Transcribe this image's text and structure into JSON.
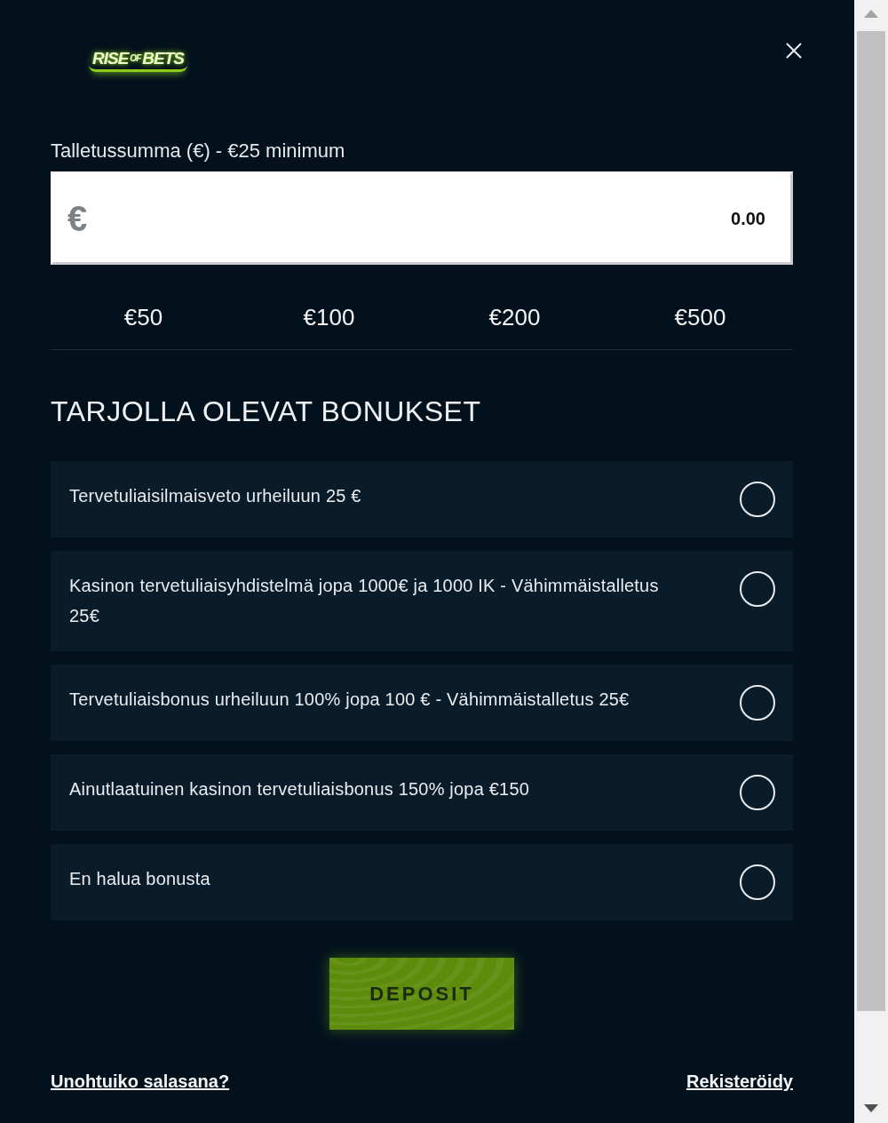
{
  "logo": {
    "parts": [
      "RISE",
      "OF",
      "BETS"
    ]
  },
  "amount": {
    "label": "Talletussumma (€) - €25 minimum",
    "currency": "€",
    "value": "0.00"
  },
  "quick_amounts": [
    "€50",
    "€100",
    "€200",
    "€500"
  ],
  "bonuses": {
    "heading": "TARJOLLA OLEVAT BONUKSET",
    "items": [
      {
        "label": "Tervetuliaisilmaisveto urheiluun 25 €",
        "selected": false
      },
      {
        "label": "Kasinon tervetuliaisyhdistelmä jopa 1000€ ja 1000 IK - Vähimmäistalletus 25€",
        "selected": false
      },
      {
        "label": "Tervetuliaisbonus urheiluun 100% jopa 100 € - Vähimmäistalletus 25€",
        "selected": false
      },
      {
        "label": "Ainutlaatuinen kasinon tervetuliaisbonus 150% jopa €150",
        "selected": false
      },
      {
        "label": "En halua bonusta",
        "selected": false
      }
    ]
  },
  "deposit_button": "DEPOSIT",
  "links": [
    "Unohtuiko salasana?",
    "Rekisteröidy"
  ]
}
